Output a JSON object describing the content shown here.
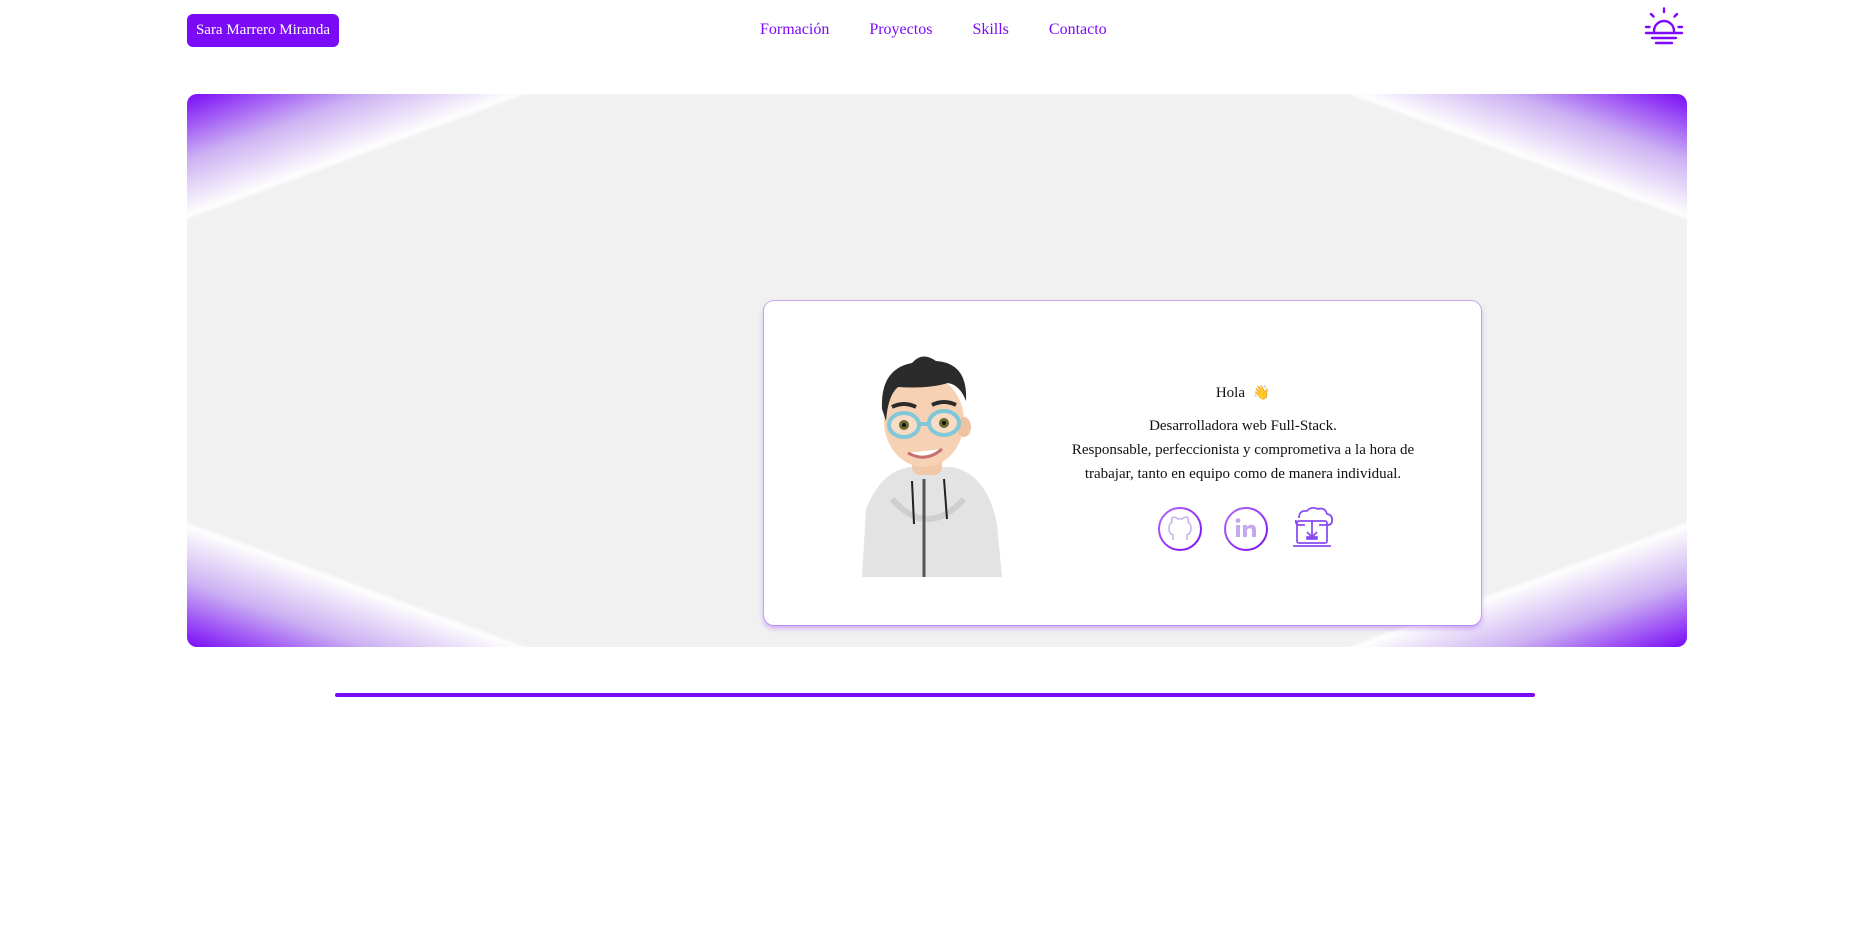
{
  "header": {
    "brand": "Sara Marrero Miranda",
    "nav": [
      "Formación",
      "Proyectos",
      "Skills",
      "Contacto"
    ],
    "theme_icon": "sun-rising-icon"
  },
  "intro": {
    "greeting": "Hola",
    "wave_emoji": "👋",
    "role": "Desarrolladora web Full-Stack.",
    "summary_line1": "Responsable, perfeccionista y comprometiva a la hora de",
    "summary_line2": "trabajar, tanto en equipo como de manera individual.",
    "socials": [
      {
        "icon": "github-icon"
      },
      {
        "icon": "linkedin-icon"
      },
      {
        "icon": "download-cv-icon"
      }
    ]
  },
  "colors": {
    "accent": "#7a0af7",
    "hero_background": "#f1f1f1"
  }
}
